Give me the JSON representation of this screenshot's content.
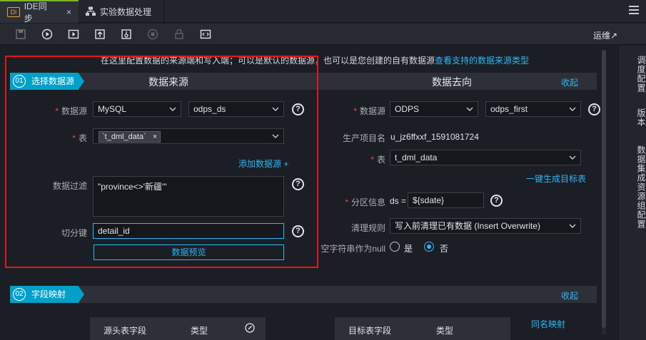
{
  "tabs": [
    {
      "badge": "Di",
      "label": "IDE同步",
      "close": "×"
    },
    {
      "label": "实验数据处理"
    }
  ],
  "toolbar": {
    "icons": [
      "save-icon",
      "run-icon",
      "run-params-icon",
      "submit-icon",
      "publish-icon",
      "stop-icon",
      "lock-icon",
      "code-icon"
    ],
    "ops_link": "运维↗"
  },
  "sidebar": {
    "items": [
      "调度配置",
      "版本",
      "数据集成资源组配置"
    ]
  },
  "notice": {
    "text": "在这里配置数据的来源端和写入端；可以是默认的数据源，也可以是您创建的自有数据源",
    "link": "查看支持的数据来源类型"
  },
  "step1": {
    "num": "01",
    "label": "选择数据源",
    "source_title": "数据来源",
    "target_title": "数据去向",
    "collapse": "收起"
  },
  "source": {
    "datasource_label": "数据源",
    "datasource_type": "MySQL",
    "datasource_name": "odps_ds",
    "table_label": "表",
    "table_chip": "`t_dml_data`",
    "chip_close": "×",
    "add_datasource": "添加数据源 +",
    "filter_label": "数据过滤",
    "filter_value": "\"province<>'新疆'\"",
    "split_label": "切分键",
    "split_value": "detail_id",
    "preview_button": "数据预览"
  },
  "target": {
    "datasource_label": "数据源",
    "datasource_type": "ODPS",
    "datasource_name": "odps_first",
    "project_label": "生产项目名",
    "project_value": "u_jz6ffxxf_1591081724",
    "table_label": "表",
    "table_value": "t_dml_data",
    "gen_table_link": "一键生成目标表",
    "partition_label": "分区信息",
    "partition_prefix": "ds =",
    "partition_value": "${sdate}",
    "cleanup_label": "清理规则",
    "cleanup_value": "写入前清理已有数据 (Insert Overwrite)",
    "null_label": "空字符串作为null",
    "yes": "是",
    "no": "否",
    "null_selected": "否"
  },
  "step2": {
    "num": "02",
    "label": "字段映射",
    "collapse": "收起",
    "source_col_field": "源头表字段",
    "source_col_type": "类型",
    "target_col_field": "目标表字段",
    "target_col_type": "类型",
    "same_name_map": "同名映射"
  },
  "colors": {
    "accent": "#2db7f5",
    "step": "#00a1c9",
    "required": "#e74c3c",
    "highlight_box": "#e0181f",
    "active_tab": "#7db52c"
  }
}
